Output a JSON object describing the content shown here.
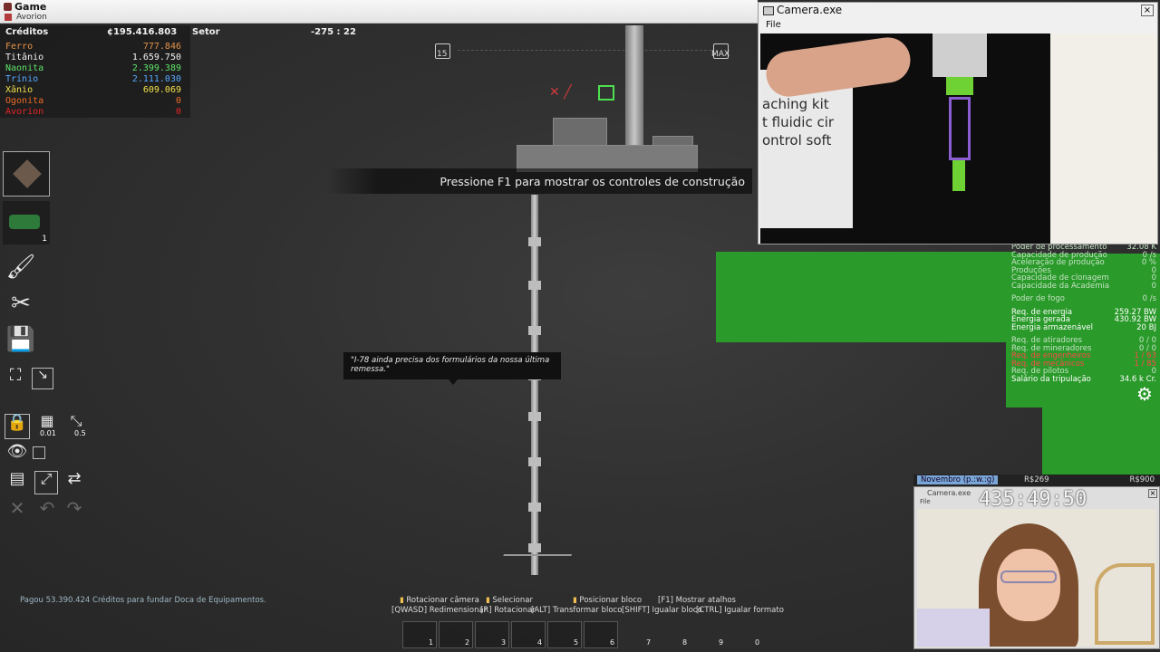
{
  "window": {
    "title": "Game",
    "subtitle": "Avorion"
  },
  "resources": {
    "credits_label": "Créditos",
    "credits_value": "¢195.416.803",
    "sector_label": "Setor",
    "items": [
      {
        "name": "Ferro",
        "value": "777.846",
        "color": "#e5924a"
      },
      {
        "name": "Titânio",
        "value": "1.659.750",
        "color": "#f2f2f2"
      },
      {
        "name": "Naonita",
        "value": "2.399.389",
        "color": "#5fe36a"
      },
      {
        "name": "Trínio",
        "value": "2.111.030",
        "color": "#57a8ff"
      },
      {
        "name": "Xânio",
        "value": "609.069",
        "color": "#f2e14a"
      },
      {
        "name": "Ogonita",
        "value": "0",
        "color": "#ef6a23"
      },
      {
        "name": "Avorion",
        "value": "0",
        "color": "#e82525"
      }
    ]
  },
  "sector_coord": "-275 : 22",
  "hud_top": {
    "left_label": "15",
    "right_label": "MAX"
  },
  "build_banner": "Pressione F1 para mostrar os controles de construção",
  "dialog": "\"I-78 ainda precisa dos formulários da nossa última remessa.\"",
  "ship_stats": [
    {
      "k": "Poder de processamento",
      "v": "32.08 K",
      "c": "#c5e3c5"
    },
    {
      "k": "Capacidade de produção",
      "v": "0 /s",
      "c": "#c5e3c5"
    },
    {
      "k": "Aceleração de produção",
      "v": "0 %",
      "c": "#c5e3c5"
    },
    {
      "k": "Produções",
      "v": "0",
      "c": "#c5e3c5"
    },
    {
      "k": "Capacidade de clonagem",
      "v": "0",
      "c": "#c5e3c5"
    },
    {
      "k": "Capacidade da Academia",
      "v": "0",
      "c": "#c5e3c5"
    },
    {
      "k": "",
      "v": "",
      "c": "",
      "gap": true
    },
    {
      "k": "Poder de fogo",
      "v": "0 /s",
      "c": "#c5e3c5"
    },
    {
      "k": "",
      "v": "",
      "c": "",
      "gap": true
    },
    {
      "k": "Req. de energia",
      "v": "259.27 BW",
      "c": "#ffffff"
    },
    {
      "k": "Energia gerada",
      "v": "430.92 BW",
      "c": "#ffffff"
    },
    {
      "k": "Energia armazenável",
      "v": "20 BJ",
      "c": "#ffffff"
    },
    {
      "k": "",
      "v": "",
      "c": "",
      "gap": true
    },
    {
      "k": "Req. de atiradores",
      "v": "0 / 0",
      "c": "#c5e3c5"
    },
    {
      "k": "Req. de mineradores",
      "v": "0 / 0",
      "c": "#c5e3c5"
    },
    {
      "k": "Req. de engenheiros",
      "v": "1 / 63",
      "c": "#ff4a4a"
    },
    {
      "k": "Req. de mecânicos",
      "v": "1 / 85",
      "c": "#ff4a4a"
    },
    {
      "k": "Req. de pilotos",
      "v": "0",
      "c": "#c5e3c5"
    },
    {
      "k": "Salário da tripulação",
      "v": "34.6 k Cr.",
      "c": "#ffffff"
    }
  ],
  "camera_window": {
    "title": "Camera.exe",
    "menu": "File",
    "close": "×",
    "sign_text": "aching kit\nt fluidic cir\nontrol soft"
  },
  "webcam": {
    "bar_left": "Novembro (p.:w.:g)",
    "bar_mid": "R$269",
    "bar_right": "R$900",
    "title": "Camera.exe",
    "menu": "File",
    "timer": "435:49:50"
  },
  "tool_values": {
    "grid": "0.01",
    "scale": "0.5",
    "count_badge": "1"
  },
  "hints": [
    {
      "text": "Rotacionar câmera"
    },
    {
      "text": "Selecionar"
    },
    {
      "text": "Posicionar bloco"
    },
    {
      "text": "[F1] Mostrar atalhos"
    },
    {
      "text": "[QWASD] Redimensionar"
    },
    {
      "text": "[R] Rotacionar"
    },
    {
      "text": "[ALT] Transformar bloco"
    },
    {
      "text": "[SHIFT] Igualar bloco"
    },
    {
      "text": "[CTRL] Igualar formato"
    }
  ],
  "hotbar": [
    "1",
    "2",
    "3",
    "4",
    "5",
    "6",
    "7",
    "8",
    "9",
    "0"
  ],
  "footer_message": "Pagou 53.390.424 Créditos para fundar Doca de Equipamentos."
}
